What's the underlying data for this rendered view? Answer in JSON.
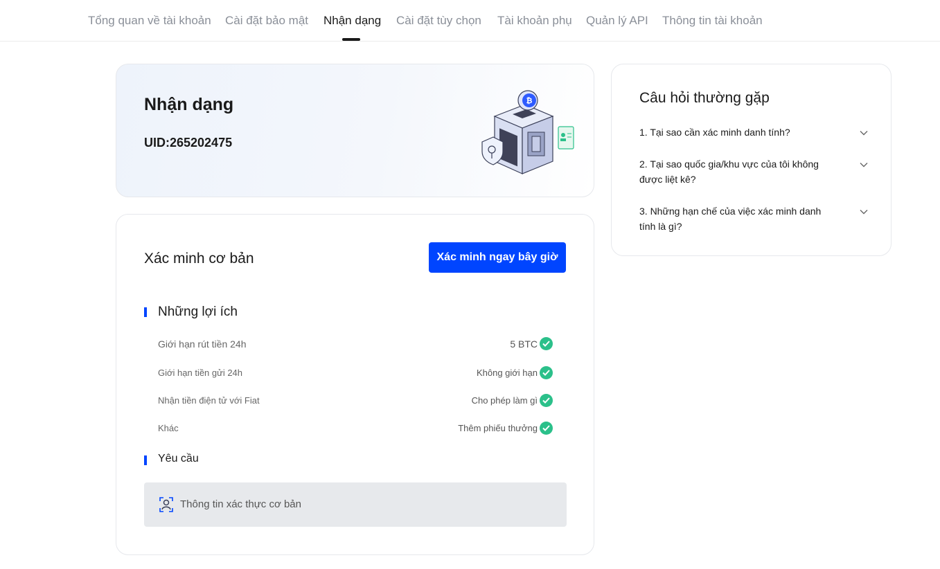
{
  "tabs": [
    {
      "label": "Tổng quan về tài khoản"
    },
    {
      "label": "Cài đặt bảo mật"
    },
    {
      "label": "Nhận dạng"
    },
    {
      "label": "Cài đặt tùy chọn"
    },
    {
      "label": "Tài khoản phụ"
    },
    {
      "label": "Quản lý API"
    },
    {
      "label": "Thông tin tài khoản"
    }
  ],
  "active_tab": "Nhận dạng",
  "identity": {
    "title": "Nhận dạng",
    "uid": "UID:265202475"
  },
  "verification": {
    "title": "Xác minh cơ bản",
    "button": "Xác minh ngay bây giờ",
    "benefits_heading": "Những lợi ích",
    "benefits": [
      {
        "label": "Giới hạn rút tiền 24h",
        "value": "5 BTC"
      },
      {
        "label": "Giới hạn tiền gửi 24h",
        "value": "Không giới hạn"
      },
      {
        "label": "Nhận tiền điện tử với Fiat",
        "value": "Cho phép làm gì"
      },
      {
        "label": "Khác",
        "value": "Thêm phiếu thưởng"
      }
    ],
    "requirements_heading": "Yêu cầu",
    "requirement_item": "Thông tin xác thực cơ bản"
  },
  "faq": {
    "title": "Câu hỏi thường gặp",
    "items": [
      {
        "question": "1. Tại sao cần xác minh danh tính?"
      },
      {
        "question": "2. Tại sao quốc gia/khu vực của tôi không được liệt kê?"
      },
      {
        "question": "3. Những hạn chế của việc xác minh danh tính là gì?"
      }
    ]
  },
  "colors": {
    "accent": "#0045ff",
    "check": "#2bc08a",
    "muted_text": "#8a8f98"
  },
  "icons": [
    "check-icon",
    "chevron-down-icon",
    "face-scan-icon",
    "identity-box-illustration"
  ]
}
